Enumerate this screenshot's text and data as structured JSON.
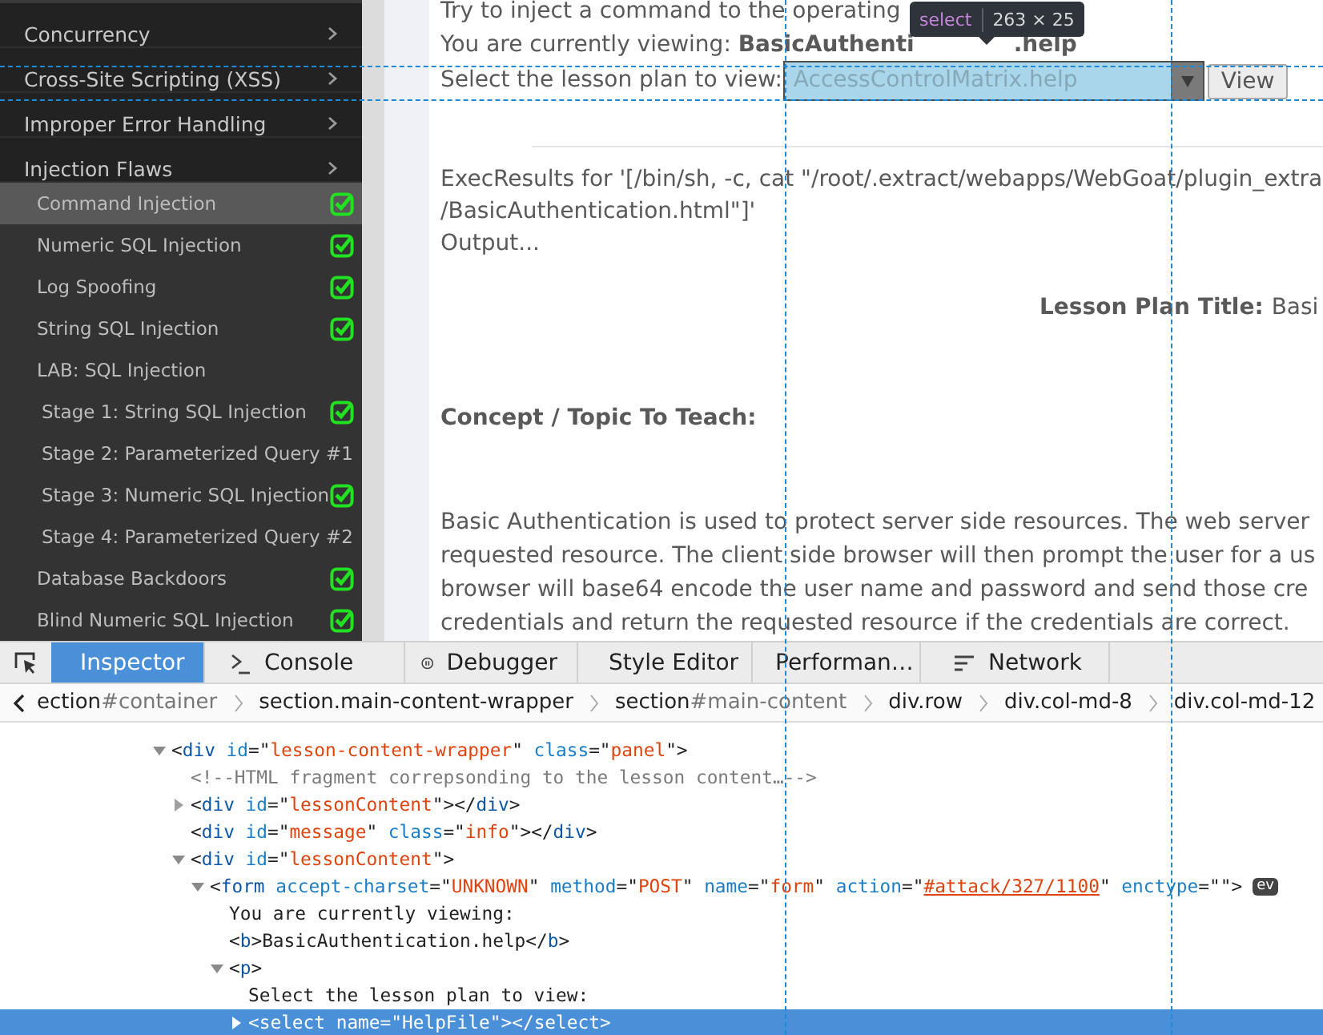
{
  "sidebar": {
    "sections": [
      {
        "label": "Concurrency"
      },
      {
        "label": "Cross-Site Scripting (XSS)"
      },
      {
        "label": "Improper Error Handling"
      },
      {
        "label": "Injection Flaws",
        "lessons": [
          {
            "label": "Command Injection",
            "selected": true,
            "completed": true
          },
          {
            "label": "Numeric SQL Injection",
            "selected": false,
            "completed": true
          },
          {
            "label": "Log Spoofing",
            "selected": false,
            "completed": true
          },
          {
            "label": "String SQL Injection",
            "selected": false,
            "completed": true
          },
          {
            "label": "LAB: SQL Injection",
            "selected": false,
            "completed": false,
            "children": [
              {
                "label": "Stage 1: String SQL Injection",
                "selected": false,
                "completed": true
              },
              {
                "label": "Stage 2: Parameterized Query #1",
                "selected": false,
                "completed": false
              },
              {
                "label": "Stage 3: Numeric SQL Injection",
                "selected": false,
                "completed": true
              },
              {
                "label": "Stage 4: Parameterized Query #2",
                "selected": false,
                "completed": false
              }
            ]
          },
          {
            "label": "Database Backdoors",
            "selected": false,
            "completed": true
          },
          {
            "label": "Blind Numeric SQL Injection",
            "selected": false,
            "completed": true
          }
        ]
      }
    ]
  },
  "lesson": {
    "intro": "Try to inject a command to the operating",
    "viewing": {
      "label": "You are currently viewing:",
      "value_start": "BasicAuthenti",
      "value_end": ".help"
    },
    "select_label": "Select the lesson plan to view:",
    "select_value": "AccessControlMatrix.help",
    "view_button": "View",
    "exec_lines": [
      "ExecResults for '[/bin/sh, -c, cat \"/root/.extract/webapps/WebGoat/plugin_extra",
      "/BasicAuthentication.html\"]'",
      "Output..."
    ],
    "plan_title": {
      "label": "Lesson Plan Title:",
      "value": "Basi"
    },
    "concept_heading": "Concept / Topic To Teach:",
    "paragraph_lines": [
      "Basic Authentication is used to protect server side resources. The web server",
      "requested resource. The client side browser will then prompt the user for a us",
      "browser will base64 encode the user name and password and send those cre",
      "credentials and return the requested resource if the credentials are correct."
    ]
  },
  "highlighter": {
    "tag": "select",
    "size": "263 × 25"
  },
  "devtools": {
    "tabs": [
      {
        "label": "Inspector",
        "selected": true
      },
      {
        "label": "Console",
        "selected": false
      },
      {
        "label": "Debugger",
        "selected": false
      },
      {
        "label": "Style Editor",
        "selected": false
      },
      {
        "label": "Performan…",
        "selected": false
      },
      {
        "label": "Network",
        "selected": false
      }
    ],
    "breadcrumbs": [
      {
        "tag": "ection",
        "id": "#container"
      },
      {
        "tag": "section.main-content-wrapper"
      },
      {
        "tag": "section",
        "id": "#main-content"
      },
      {
        "tag": "div.row"
      },
      {
        "tag": "div.col-md-8"
      },
      {
        "tag": "div.col-md-12"
      }
    ],
    "markup": {
      "tokens": [
        {
          "kind": "punct",
          "text": "<"
        },
        {
          "kind": "tag",
          "text": "div"
        },
        {
          "kind": "attr",
          "text": "id"
        },
        {
          "kind": "punct",
          "text": "=\""
        },
        {
          "kind": "value",
          "text": "lesson-content-wrapper"
        },
        {
          "kind": "punct",
          "text": "\""
        },
        {
          "kind": "attr",
          "text": "class"
        },
        {
          "kind": "punct",
          "text": "=\""
        },
        {
          "kind": "value",
          "text": "panel"
        },
        {
          "kind": "punct",
          "text": "\">"
        }
      ],
      "expanded": true,
      "selected": false,
      "children": [
        {
          "tokens": [
            {
              "kind": "comment",
              "text": "<!--HTML fragment correpsonding to the lesson content…-->"
            }
          ],
          "selected": false
        },
        {
          "tokens": [
            {
              "kind": "punct",
              "text": "<"
            },
            {
              "kind": "tag",
              "text": "div"
            },
            {
              "kind": "attr",
              "text": "id"
            },
            {
              "kind": "punct",
              "text": "=\""
            },
            {
              "kind": "value",
              "text": "lessonContent"
            },
            {
              "kind": "punct",
              "text": "\"></"
            },
            {
              "kind": "tag",
              "text": "div"
            },
            {
              "kind": "punct",
              "text": ">"
            }
          ],
          "expanded": false,
          "selected": false
        },
        {
          "tokens": [
            {
              "kind": "punct",
              "text": "<"
            },
            {
              "kind": "tag",
              "text": "div"
            },
            {
              "kind": "attr",
              "text": "id"
            },
            {
              "kind": "punct",
              "text": "=\""
            },
            {
              "kind": "value",
              "text": "message"
            },
            {
              "kind": "punct",
              "text": "\""
            },
            {
              "kind": "attr",
              "text": "class"
            },
            {
              "kind": "punct",
              "text": "=\""
            },
            {
              "kind": "value",
              "text": "info"
            },
            {
              "kind": "punct",
              "text": "\"></"
            },
            {
              "kind": "tag",
              "text": "div"
            },
            {
              "kind": "punct",
              "text": ">"
            }
          ],
          "selected": false
        },
        {
          "tokens": [
            {
              "kind": "punct",
              "text": "<"
            },
            {
              "kind": "tag",
              "text": "div"
            },
            {
              "kind": "attr",
              "text": "id"
            },
            {
              "kind": "punct",
              "text": "=\""
            },
            {
              "kind": "value",
              "text": "lessonContent"
            },
            {
              "kind": "punct",
              "text": "\">"
            }
          ],
          "expanded": true,
          "selected": false,
          "children": [
            {
              "tokens": [
                {
                  "kind": "punct",
                  "text": "<"
                },
                {
                  "kind": "tag",
                  "text": "form"
                },
                {
                  "kind": "attr",
                  "text": "accept-charset"
                },
                {
                  "kind": "punct",
                  "text": "=\""
                },
                {
                  "kind": "value",
                  "text": "UNKNOWN"
                },
                {
                  "kind": "punct",
                  "text": "\""
                },
                {
                  "kind": "attr",
                  "text": "method"
                },
                {
                  "kind": "punct",
                  "text": "=\""
                },
                {
                  "kind": "value",
                  "text": "POST"
                },
                {
                  "kind": "punct",
                  "text": "\""
                },
                {
                  "kind": "attr",
                  "text": "name"
                },
                {
                  "kind": "punct",
                  "text": "=\""
                },
                {
                  "kind": "value",
                  "text": "form"
                },
                {
                  "kind": "punct",
                  "text": "\""
                },
                {
                  "kind": "attr",
                  "text": "action"
                },
                {
                  "kind": "punct",
                  "text": "=\""
                },
                {
                  "kind": "link",
                  "text": "#attack/327/1100"
                },
                {
                  "kind": "punct",
                  "text": "\""
                },
                {
                  "kind": "attr",
                  "text": "enctype"
                },
                {
                  "kind": "punct",
                  "text": "=\"\">"
                }
              ],
              "expanded": true,
              "badge": "ev",
              "selected": false,
              "children": [
                {
                  "tokens": [
                    {
                      "kind": "text",
                      "text": "You are currently viewing:"
                    }
                  ],
                  "selected": false
                },
                {
                  "tokens": [
                    {
                      "kind": "punct",
                      "text": "<"
                    },
                    {
                      "kind": "tag",
                      "text": "b"
                    },
                    {
                      "kind": "punct",
                      "text": ">"
                    },
                    {
                      "kind": "text",
                      "text": "BasicAuthentication.help"
                    },
                    {
                      "kind": "punct",
                      "text": "</"
                    },
                    {
                      "kind": "tag",
                      "text": "b"
                    },
                    {
                      "kind": "punct",
                      "text": ">"
                    }
                  ],
                  "selected": false
                },
                {
                  "tokens": [
                    {
                      "kind": "punct",
                      "text": "<"
                    },
                    {
                      "kind": "tag",
                      "text": "p"
                    },
                    {
                      "kind": "punct",
                      "text": ">"
                    }
                  ],
                  "expanded": true,
                  "selected": false,
                  "children": [
                    {
                      "tokens": [
                        {
                          "kind": "text",
                          "text": "Select the lesson plan to view:"
                        }
                      ],
                      "selected": false
                    },
                    {
                      "tokens": [
                        {
                          "kind": "punct",
                          "text": "<"
                        },
                        {
                          "kind": "tag",
                          "text": "select"
                        },
                        {
                          "kind": "attr",
                          "text": "name"
                        },
                        {
                          "kind": "punct",
                          "text": "=\""
                        },
                        {
                          "kind": "value",
                          "text": "HelpFile"
                        },
                        {
                          "kind": "punct",
                          "text": "\"></"
                        },
                        {
                          "kind": "tag",
                          "text": "select"
                        },
                        {
                          "kind": "punct",
                          "text": ">"
                        }
                      ],
                      "expanded": false,
                      "selected": true
                    }
                  ]
                }
              ]
            }
          ]
        }
      ]
    }
  }
}
